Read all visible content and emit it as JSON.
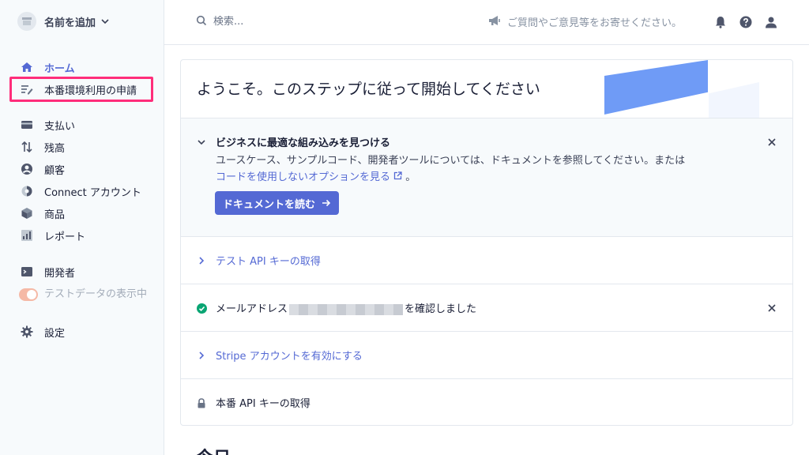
{
  "sidebar": {
    "account": {
      "name": "名前を追加"
    },
    "items": [
      {
        "label": "ホーム",
        "icon": "home-icon"
      },
      {
        "label": "本番環境利用の申請",
        "icon": "activation-form-icon"
      },
      {
        "label": "支払い",
        "icon": "payments-icon"
      },
      {
        "label": "残高",
        "icon": "balance-icon"
      },
      {
        "label": "顧客",
        "icon": "customer-icon"
      },
      {
        "label": "Connect アカウント",
        "icon": "connect-icon"
      },
      {
        "label": "商品",
        "icon": "box-icon"
      },
      {
        "label": "レポート",
        "icon": "report-icon"
      },
      {
        "label": "開発者",
        "icon": "terminal-icon"
      },
      {
        "label": "設定",
        "icon": "gear-icon"
      }
    ],
    "test_toggle": {
      "label": "テストデータの表示中"
    }
  },
  "header": {
    "search_placeholder": "検索...",
    "feedback": "ご質問やご意見等をお寄せください。"
  },
  "card": {
    "title": "ようこそ。このステップに従って開始してください",
    "steps": [
      {
        "title": "ビジネスに最適な組み込みを見つける",
        "desc_prefix": "ユースケース、サンプルコード、開発者ツールについては、ドキュメントを参照してください。または",
        "desc_link": "コードを使用しないオプションを見る",
        "desc_suffix": "。",
        "button": "ドキュメントを読む"
      },
      {
        "title": "テスト API キーの取得"
      },
      {
        "title_prefix": "メールアドレス",
        "title_suffix": "を確認しました"
      },
      {
        "title": "Stripe アカウントを有効にする"
      },
      {
        "title": "本番 API キーの取得"
      }
    ]
  },
  "below_heading": "今日",
  "colors": {
    "accent": "#5469d4",
    "highlight": "#ff2d7a",
    "success": "#09a573"
  }
}
